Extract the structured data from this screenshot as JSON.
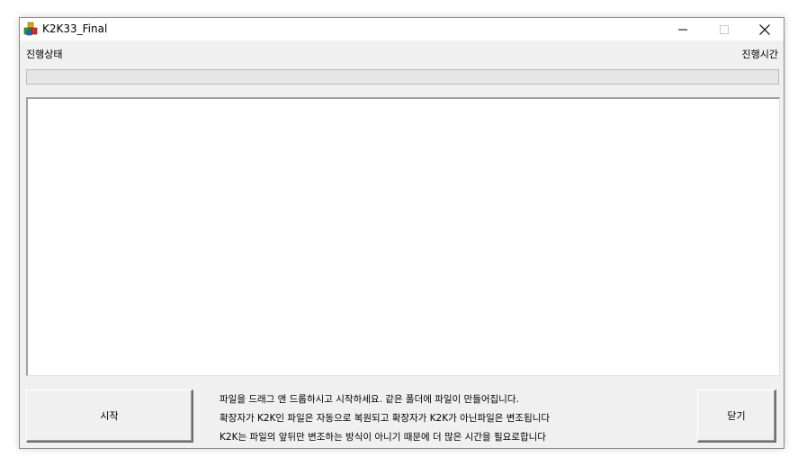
{
  "window": {
    "title": "K2K33_Final",
    "icon": "app-blocks-icon",
    "controls": {
      "minimize": "—",
      "maximize": "☐",
      "close": "✕"
    }
  },
  "status": {
    "left_label": "진행상태",
    "right_label": "진행시간",
    "progress": 0
  },
  "log": {
    "content": ""
  },
  "buttons": {
    "start": "시작",
    "close": "닫기"
  },
  "info": {
    "lines": [
      "파일을 드래그 앤 드롭하시고 시작하세요. 같은 폴더에 파일이 만들어집니다.",
      "확장자가 K2K인 파일은 자동으로 복원되고 확장자가 K2K가 아닌파일은 변조됩니다",
      "K2K는 파일의 앞뒤만 변조하는 방식이 아니기 때문에 더 많은 시간을 필요로합니다"
    ]
  },
  "colors": {
    "window_bg": "#f0f0f0",
    "titlebar_bg": "#ffffff",
    "progress_fill": "#06b025"
  }
}
